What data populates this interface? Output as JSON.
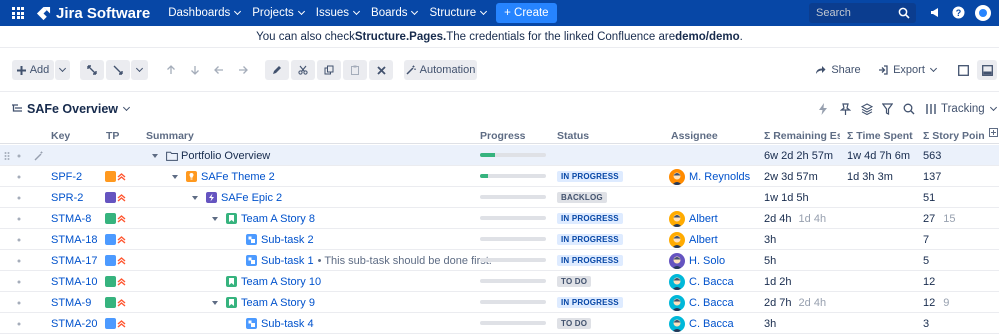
{
  "nav": {
    "app_name": "Jira Software",
    "menus": [
      "Dashboards",
      "Projects",
      "Issues",
      "Boards",
      "Structure"
    ],
    "create_label": "+ Create",
    "search_placeholder": "Search",
    "brand_color": "#0747a6"
  },
  "banner": {
    "pre": "You can also check ",
    "link": "Structure.Pages.",
    "mid": " The credentials for the linked Confluence are ",
    "creds": "demo/demo",
    "post": "."
  },
  "toolbar": {
    "add_label": "Add",
    "automation_label": "Automation",
    "share_label": "Share",
    "export_label": "Export"
  },
  "view": {
    "title": "SAFe Overview",
    "tracking_label": "Tracking"
  },
  "columns": [
    "Key",
    "TP",
    "Summary",
    "Progress",
    "Status",
    "Assignee",
    "Σ Remaining Estim",
    "Σ Time Spent",
    "Σ Story Poin"
  ],
  "rows": [
    {
      "key": "",
      "summary": "Portfolio Overview",
      "note": "",
      "status": "",
      "assignee": "",
      "remaining": "6w 2d 2h 57m",
      "remaining_orig": "",
      "spent": "1w 4d 7h 6m",
      "points": "563",
      "points_extra": "",
      "progress": 0.22,
      "indent": 0,
      "type": "folder",
      "twisty": true
    },
    {
      "key": "SPF-2",
      "summary": "SAFe Theme 2",
      "note": "",
      "status": "IN PROGRESS",
      "assignee": "M. Reynolds",
      "remaining": "2w 3d 57m",
      "remaining_orig": "",
      "spent": "1d 3h 3m",
      "points": "137",
      "points_extra": "",
      "progress": 0.12,
      "indent": 1,
      "type": "theme",
      "twisty": true
    },
    {
      "key": "SPR-2",
      "summary": "SAFe Epic 2",
      "note": "",
      "status": "BACKLOG",
      "assignee": "",
      "remaining": "1w 1d 5h",
      "remaining_orig": "",
      "spent": "",
      "points": "51",
      "points_extra": "",
      "progress": 0,
      "indent": 2,
      "type": "epic",
      "twisty": true
    },
    {
      "key": "STMA-8",
      "summary": "Team A Story 8",
      "note": "",
      "status": "IN PROGRESS",
      "assignee": "Albert",
      "remaining": "2d 4h",
      "remaining_orig": "1d 4h",
      "spent": "",
      "points": "27",
      "points_extra": "15",
      "progress": 0,
      "indent": 3,
      "type": "story",
      "twisty": true
    },
    {
      "key": "STMA-18",
      "summary": "Sub-task 2",
      "note": "",
      "status": "IN PROGRESS",
      "assignee": "Albert",
      "remaining": "3h",
      "remaining_orig": "",
      "spent": "",
      "points": "7",
      "points_extra": "",
      "progress": 0,
      "indent": 4,
      "type": "subtask",
      "twisty": false
    },
    {
      "key": "STMA-17",
      "summary": "Sub-task 1",
      "note": "This sub-task should be done first.",
      "status": "IN PROGRESS",
      "assignee": "H. Solo",
      "remaining": "5h",
      "remaining_orig": "",
      "spent": "",
      "points": "5",
      "points_extra": "",
      "progress": 0,
      "indent": 4,
      "type": "subtask",
      "twisty": false
    },
    {
      "key": "STMA-10",
      "summary": "Team A Story 10",
      "note": "",
      "status": "TO DO",
      "assignee": "C. Bacca",
      "remaining": "1d 2h",
      "remaining_orig": "",
      "spent": "",
      "points": "12",
      "points_extra": "",
      "progress": 0,
      "indent": 3,
      "type": "story",
      "twisty": false
    },
    {
      "key": "STMA-9",
      "summary": "Team A Story 9",
      "note": "",
      "status": "IN PROGRESS",
      "assignee": "C. Bacca",
      "remaining": "2d 7h",
      "remaining_orig": "2d 4h",
      "spent": "",
      "points": "12",
      "points_extra": "9",
      "progress": 0,
      "indent": 3,
      "type": "story",
      "twisty": true
    },
    {
      "key": "STMA-20",
      "summary": "Sub-task 4",
      "note": "",
      "status": "TO DO",
      "assignee": "C. Bacca",
      "remaining": "3h",
      "remaining_orig": "",
      "spent": "",
      "points": "3",
      "points_extra": "",
      "progress": 0,
      "indent": 4,
      "type": "subtask",
      "twisty": false
    }
  ]
}
